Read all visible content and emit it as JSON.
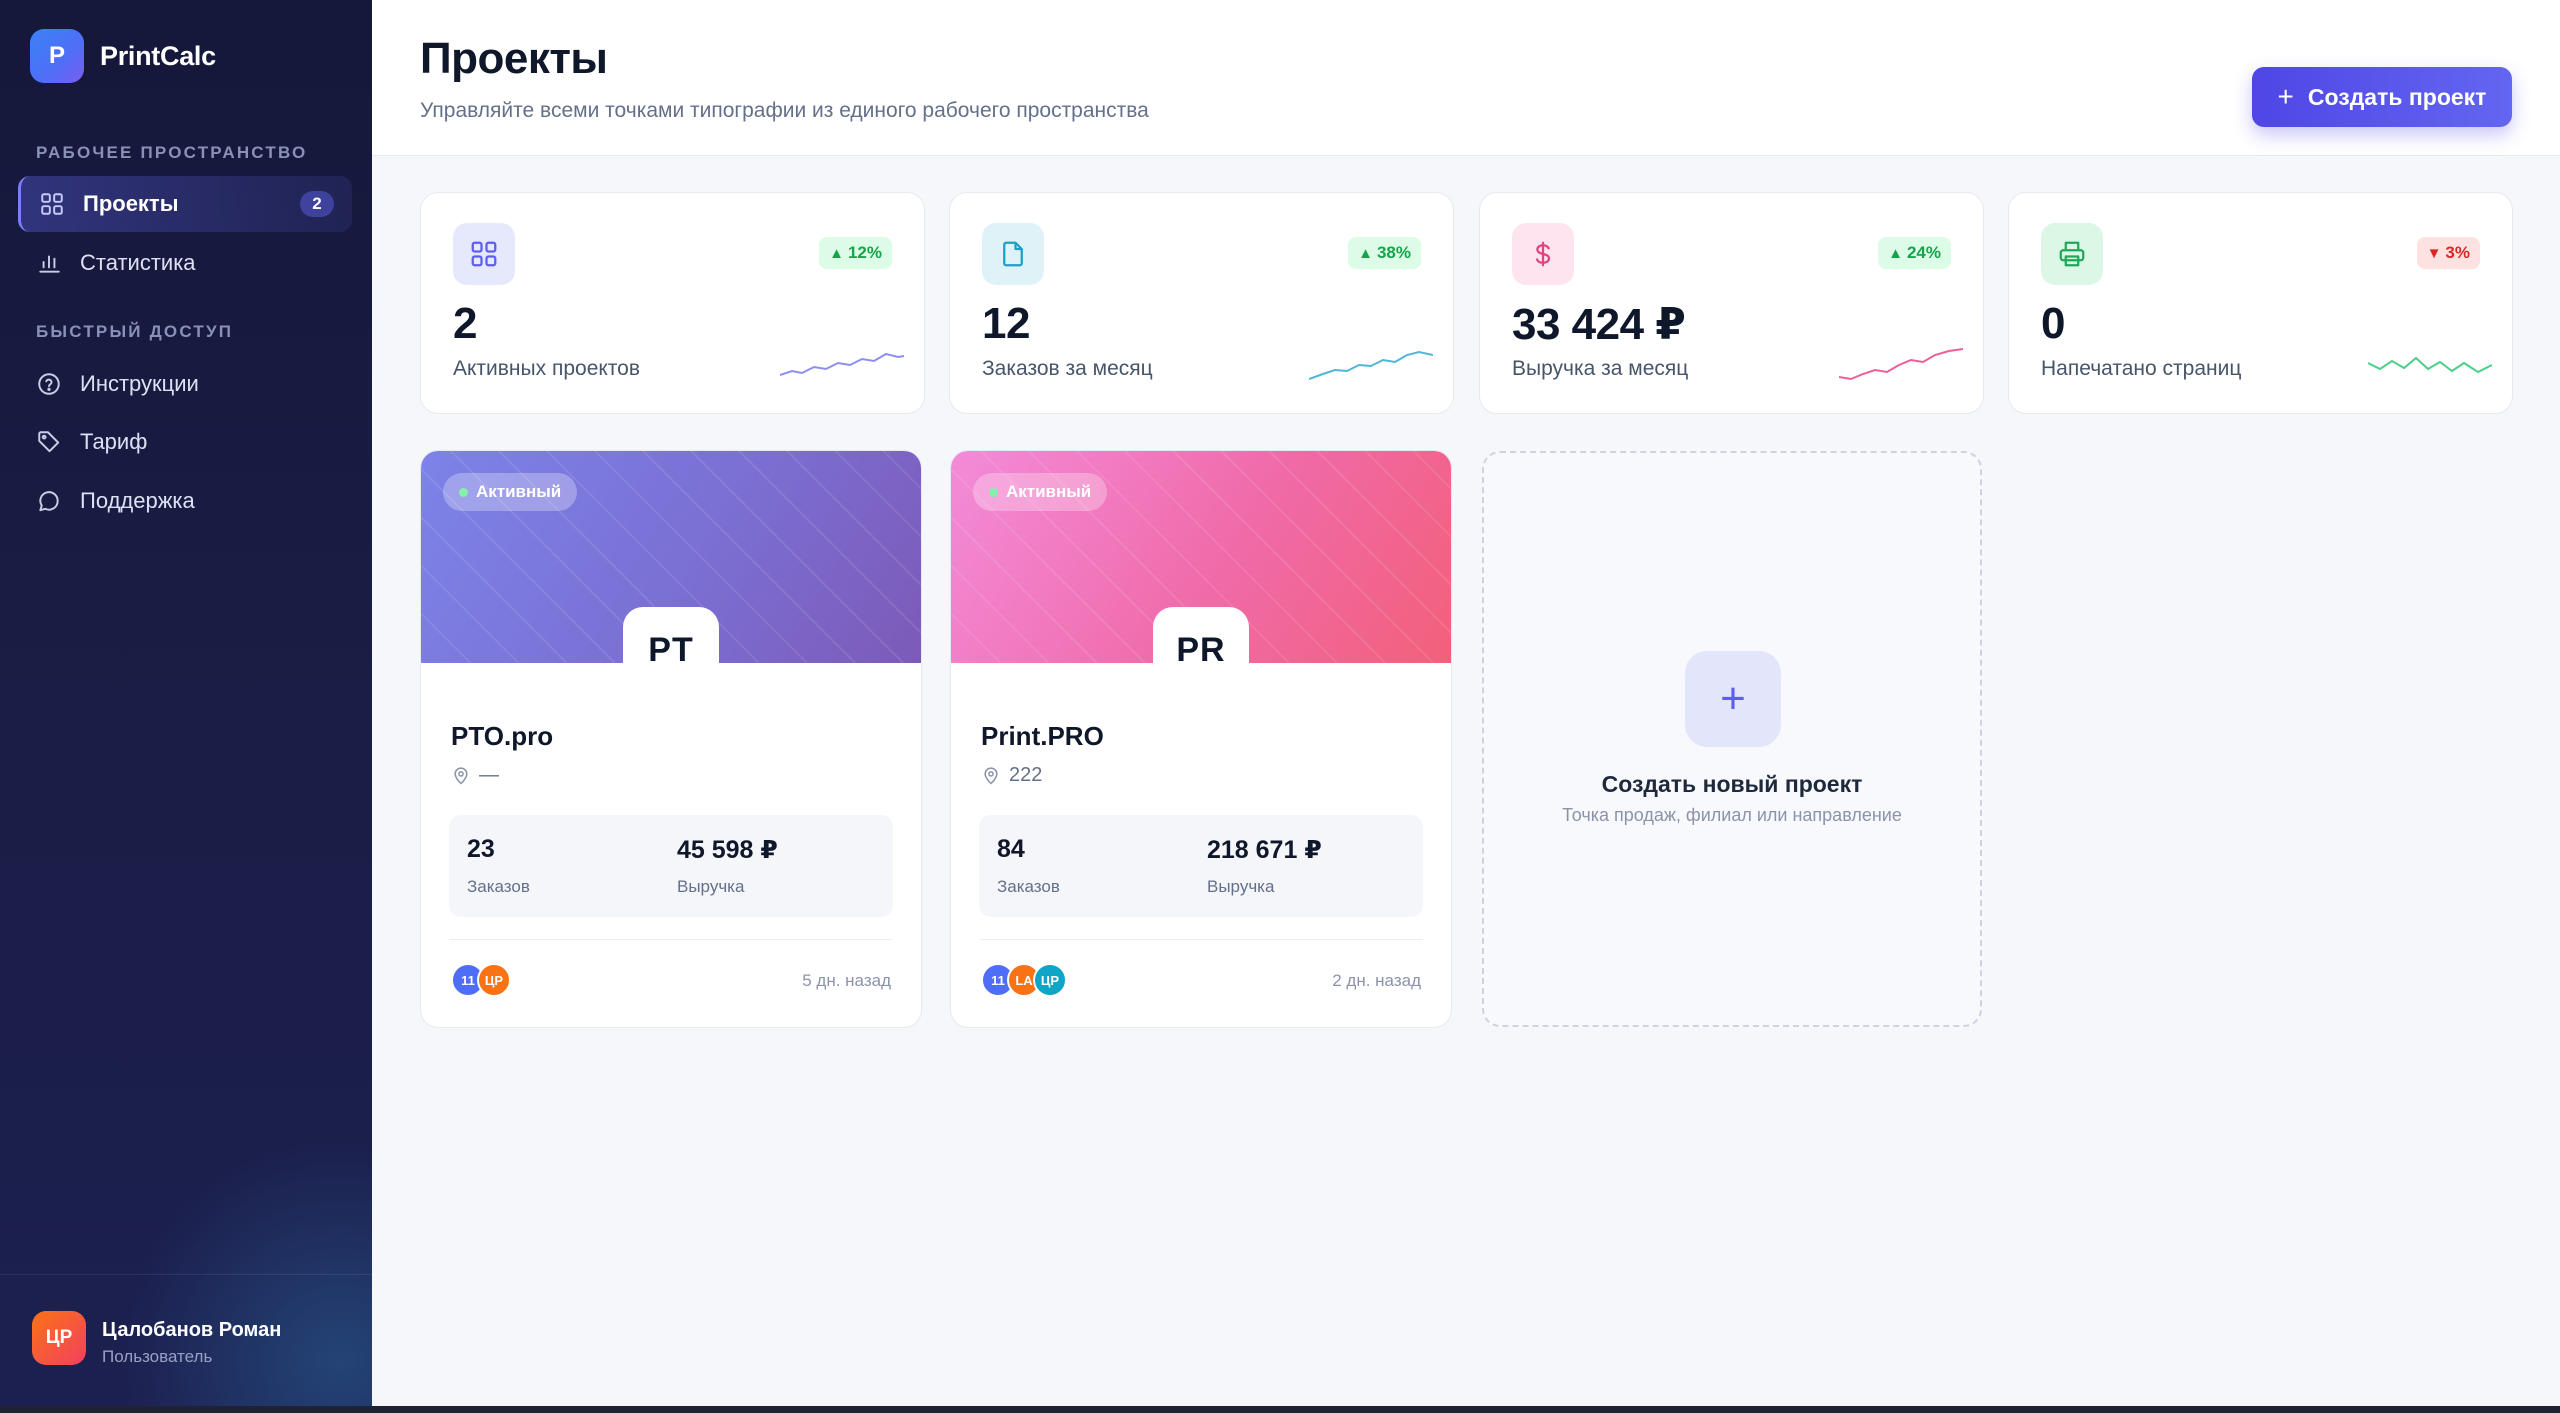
{
  "brand": {
    "logo_letter": "P",
    "name": "PrintCalc"
  },
  "sidebar": {
    "workspace_label": "РАБОЧЕЕ ПРОСТРАНСТВО",
    "quick_label": "БЫСТРЫЙ ДОСТУП",
    "items": [
      {
        "label": "Проекты",
        "icon": "grid-icon",
        "badge": "2",
        "active": true
      },
      {
        "label": "Статистика",
        "icon": "bar-chart-icon"
      },
      {
        "label": "Инструкции",
        "icon": "help-circle-icon"
      },
      {
        "label": "Тариф",
        "icon": "tag-icon"
      },
      {
        "label": "Поддержка",
        "icon": "chat-bubble-icon"
      }
    ],
    "user": {
      "initials": "ЦР",
      "name": "Цалобанов Роман",
      "role": "Пользователь"
    }
  },
  "header": {
    "title": "Проекты",
    "subtitle": "Управляйте всеми точками типографии из единого рабочего пространства",
    "create_button": "Создать проект"
  },
  "stats": [
    {
      "value": "2",
      "label": "Активных проектов",
      "trend": "12%",
      "trend_dir": "up",
      "icon": "grid-icon",
      "color": "#8b8ff0"
    },
    {
      "value": "12",
      "label": "Заказов за месяц",
      "trend": "38%",
      "trend_dir": "up",
      "icon": "file-icon",
      "color": "#4fb6d8"
    },
    {
      "value": "33 424 ₽",
      "label": "Выручка за месяц",
      "trend": "24%",
      "trend_dir": "up",
      "icon": "dollar-icon",
      "color": "#ec5f9a"
    },
    {
      "value": "0",
      "label": "Напечатано страниц",
      "trend": "3%",
      "trend_dir": "down",
      "icon": "printer-icon",
      "color": "#4ccf88"
    }
  ],
  "projects": [
    {
      "status": "Активный",
      "initials": "PT",
      "name": "PTO.pro",
      "location": "—",
      "orders": "23",
      "orders_label": "Заказов",
      "revenue": "45 598 ₽",
      "revenue_label": "Выручка",
      "members": [
        {
          "initials": "11",
          "color": "#4f6ef7"
        },
        {
          "initials": "ЦР",
          "color": "#f97316"
        }
      ],
      "updated": "5 дн. назад"
    },
    {
      "status": "Активный",
      "initials": "PR",
      "name": "Print.PRO",
      "location": "222",
      "orders": "84",
      "orders_label": "Заказов",
      "revenue": "218 671 ₽",
      "revenue_label": "Выручка",
      "members": [
        {
          "initials": "11",
          "color": "#4f6ef7"
        },
        {
          "initials": "LA",
          "color": "#f97316"
        },
        {
          "initials": "ЦР",
          "color": "#0ea5c6"
        }
      ],
      "updated": "2 дн. назад"
    }
  ],
  "new_project": {
    "title": "Создать новый проект",
    "subtitle": "Точка продаж, филиал или направление"
  }
}
